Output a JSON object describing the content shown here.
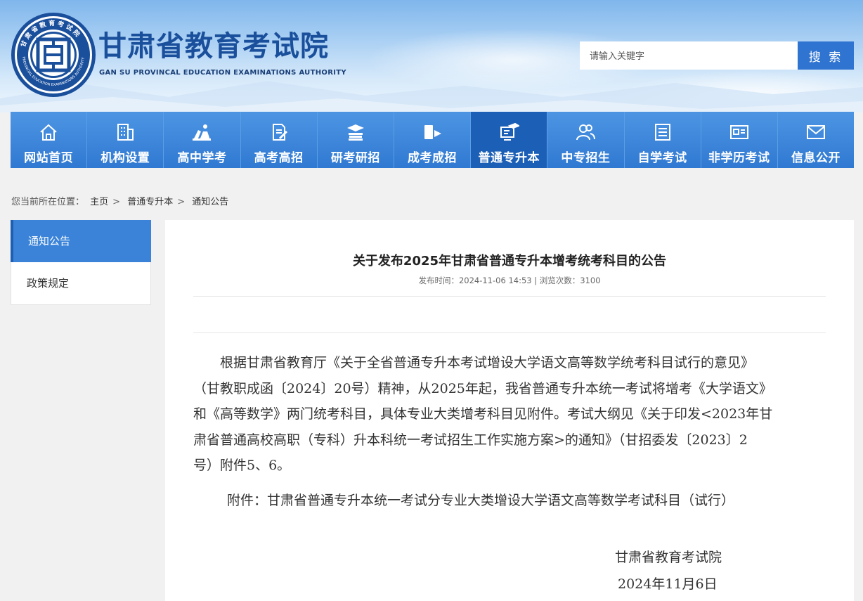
{
  "header": {
    "title": "甘肃省教育考试院",
    "subtitle": "GAN SU PROVINCAL EDUCATION EXAMINATIONS AUTHORITY",
    "emblem_text": "甘肃省教育考试院 GANSU PROVINCIAL EDUCATION EXAMINATIONS AUTHORITY"
  },
  "search": {
    "placeholder": "请输入关键字",
    "button_label": "搜 索"
  },
  "nav": {
    "items": [
      {
        "label": "网站首页",
        "icon": "home-icon"
      },
      {
        "label": "机构设置",
        "icon": "building-icon"
      },
      {
        "label": "高中学考",
        "icon": "students-icon"
      },
      {
        "label": "高考高招",
        "icon": "pencil-paper-icon"
      },
      {
        "label": "研考研招",
        "icon": "books-graduation-icon"
      },
      {
        "label": "成考成招",
        "icon": "book-flag-icon"
      },
      {
        "label": "普通专升本",
        "icon": "graduation-screen-icon",
        "active": true
      },
      {
        "label": "中专招生",
        "icon": "people-icon"
      },
      {
        "label": "自学考试",
        "icon": "document-icon"
      },
      {
        "label": "非学历考试",
        "icon": "id-card-icon"
      },
      {
        "label": "信息公开",
        "icon": "mail-icon"
      }
    ]
  },
  "breadcrumb": {
    "prefix": "您当前所在位置：",
    "items": [
      "主页",
      "普通专升本",
      "通知公告"
    ],
    "sep": ">"
  },
  "sidebar": {
    "items": [
      {
        "label": "通知公告",
        "active": true
      },
      {
        "label": "政策规定",
        "active": false
      }
    ]
  },
  "article": {
    "title": "关于发布2025年甘肃省普通专升本增考统考科目的公告",
    "meta": "发布时间：2024-11-06 14:53   |   浏览次数：3100",
    "body_lines": [
      "根据甘肃省教育厅《关于全省普通专升本考试增设大学语文高等数学统考科目试行的意见》",
      "（甘教职成函〔2024〕20号）精神，从2025年起，我省普通专升本统一考试将增考《大学语文》",
      "和《高等数学》两门统考科目，具体专业大类增考科目见附件。考试大纲见《关于印发<2023年甘",
      "肃省普通高校高职（专科）升本科统一考试招生工作实施方案>的通知》（甘招委发〔2023〕2",
      "号）附件5、6。"
    ],
    "attachment": "附件：甘肃省普通专升本统一考试分专业大类增设大学语文高等数学考试科目（试行）",
    "sign_org": "甘肃省教育考试院",
    "sign_date": "2024年11月6日"
  },
  "colors": {
    "nav": "#3584dc",
    "nav_active": "#1c5fb6",
    "title": "#1a4f9c",
    "search_button": "#2f74d0"
  }
}
